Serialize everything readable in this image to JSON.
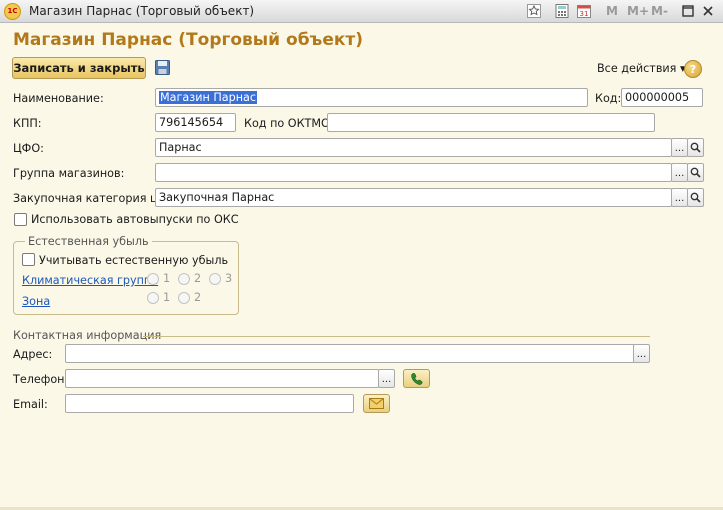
{
  "window": {
    "title": "Магазин Парнас (Торговый объект)",
    "logo_text": "1С",
    "memory_buttons": [
      "M",
      "M+",
      "M-"
    ]
  },
  "header": {
    "page_title": "Магазин Парнас (Торговый объект)",
    "save_close_label": "Записать и закрыть",
    "all_actions_label": "Все действия ▾",
    "help_label": "?"
  },
  "form": {
    "name_label": "Наименование:",
    "name_value": "Магазин Парнас",
    "code_label": "Код:",
    "code_value": "000000005",
    "kpp_label": "КПП:",
    "kpp_value": "796145654",
    "oktmo_label": "Код по ОКТМО:",
    "oktmo_value": "",
    "cfo_label": "ЦФО:",
    "cfo_value": "Парнас",
    "store_group_label": "Группа магазинов:",
    "store_group_value": "",
    "price_category_label": "Закупочная категория цен:",
    "price_category_value": "Закупочная Парнас",
    "auto_release_label": "Использовать автовыпуски по ОКС",
    "dots": "..."
  },
  "natural_loss": {
    "legend": "Естественная убыль",
    "consider_label": "Учитывать естественную убыль",
    "climate_group_link": "Климатическая группа",
    "climate_options": [
      "1",
      "2",
      "3"
    ],
    "zone_link": "Зона",
    "zone_options": [
      "1",
      "2"
    ]
  },
  "contact": {
    "legend": "Контактная информация",
    "address_label": "Адрес:",
    "address_value": "",
    "phone_label": "Телефон:",
    "phone_value": "",
    "email_label": "Email:",
    "email_value": ""
  },
  "colors": {
    "title": "#b2791a",
    "link": "#1c57b8",
    "background": "#fbf8e8",
    "selection": "#3a6fd6"
  }
}
